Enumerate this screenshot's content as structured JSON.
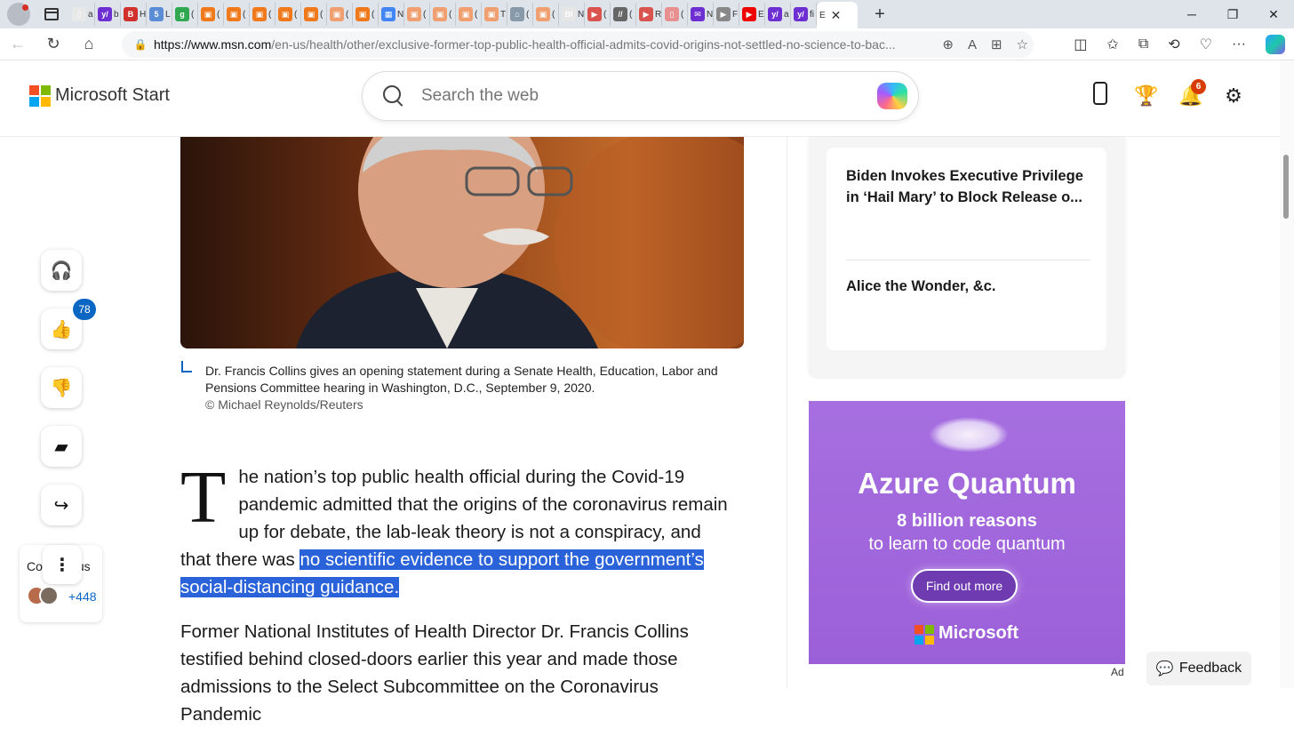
{
  "browser": {
    "tabs": [
      {
        "letter": "a",
        "color": "#e8e8e8",
        "glyph": "▯"
      },
      {
        "letter": "b",
        "color": "#6e2fd2",
        "glyph": "y/"
      },
      {
        "letter": "H",
        "color": "#d0312d",
        "glyph": "B"
      },
      {
        "letter": "L",
        "color": "#5b8dd6",
        "glyph": "5"
      },
      {
        "letter": "(",
        "color": "#2fa84f",
        "glyph": "g"
      },
      {
        "letter": "(",
        "color": "#f07a1b",
        "glyph": "▣"
      },
      {
        "letter": "(",
        "color": "#f07a1b",
        "glyph": "▣"
      },
      {
        "letter": "(",
        "color": "#f07a1b",
        "glyph": "▣"
      },
      {
        "letter": "(",
        "color": "#f07a1b",
        "glyph": "▣"
      },
      {
        "letter": "(",
        "color": "#f07a1b",
        "glyph": "▣"
      },
      {
        "letter": "(",
        "color": "#f0a070",
        "glyph": "▣"
      },
      {
        "letter": "(",
        "color": "#f07a1b",
        "glyph": "▣"
      },
      {
        "letter": "N",
        "color": "#4285f4",
        "glyph": "▦"
      },
      {
        "letter": "(",
        "color": "#f0a070",
        "glyph": "▣"
      },
      {
        "letter": "(",
        "color": "#f0a070",
        "glyph": "▣"
      },
      {
        "letter": "(",
        "color": "#f0a070",
        "glyph": "▣"
      },
      {
        "letter": "T",
        "color": "#f0a070",
        "glyph": "▣"
      },
      {
        "letter": "(",
        "color": "#8899aa",
        "glyph": "⌂"
      },
      {
        "letter": "(",
        "color": "#f0a070",
        "glyph": "▣"
      },
      {
        "letter": "N",
        "color": "#e6e6e6",
        "glyph": "BI"
      },
      {
        "letter": "(",
        "color": "#d9534f",
        "glyph": "▶"
      },
      {
        "letter": "(",
        "color": "#666",
        "glyph": "//"
      },
      {
        "letter": "R",
        "color": "#d9534f",
        "glyph": "▶"
      },
      {
        "letter": "(",
        "color": "#e89090",
        "glyph": "▯"
      },
      {
        "letter": "N",
        "color": "#6e2fd2",
        "glyph": "✉"
      },
      {
        "letter": "F",
        "color": "#888",
        "glyph": "▶"
      },
      {
        "letter": "E",
        "color": "#e00",
        "glyph": "▶"
      },
      {
        "letter": "a",
        "color": "#6e2fd2",
        "glyph": "y/"
      },
      {
        "letter": "fi",
        "color": "#6e2fd2",
        "glyph": "y/"
      }
    ],
    "active_tab_letter": "E",
    "url_host": "https://www.msn.com",
    "url_rest": "/en-us/health/other/exclusive-former-top-public-health-official-admits-covid-origins-not-settled-no-science-to-bac..."
  },
  "header": {
    "brand": "Microsoft Start",
    "search_placeholder": "Search the web",
    "notifications_count": "6"
  },
  "photo": {
    "caption": "Dr. Francis Collins gives an opening statement during a Senate Health, Education, Labor and Pensions Committee hearing in Washington, D.C., September 9, 2020.",
    "credit": "© Michael Reynolds/Reuters"
  },
  "article": {
    "drop_cap": "T",
    "p1_before": "he nation’s top public health official during the Covid-19 pandemic admitted that the origins of the coronavirus remain up for debate, the lab-leak theory is not a conspiracy, and that there was ",
    "p1_highlight": "no scientific evidence to support the government’s social-distancing guidance.",
    "p2": "Former National Institutes of Health Director Dr. Francis Collins testified behind closed-doors earlier this year and made those admissions to the Select Subcommittee on the Coronavirus Pandemic"
  },
  "rail": {
    "like_count": "78",
    "comments_label_left": "Co",
    "comments_label_right": "us",
    "comments_count": "+448"
  },
  "sidebar": {
    "stories": [
      {
        "title": "Biden Invokes Executive Privilege in ‘Hail Mary’ to Block Release o..."
      },
      {
        "title": "Alice the Wonder, &c."
      }
    ]
  },
  "ad": {
    "headline": "Azure Quantum",
    "line1": "8 billion reasons",
    "line2": "to learn to code quantum",
    "cta": "Find out more",
    "brand": "Microsoft",
    "label": "Ad"
  },
  "feedback_label": "Feedback",
  "colors": {
    "accent": "#0a66c2",
    "highlight": "#2962d9",
    "ad_background": "#a66fe0",
    "badge": "#d83b01"
  }
}
